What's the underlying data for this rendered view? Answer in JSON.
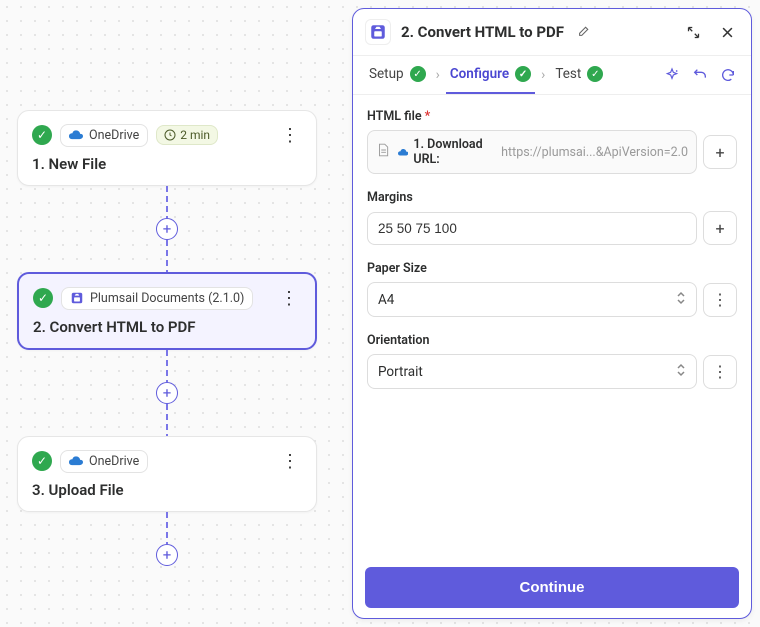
{
  "workflow": {
    "nodes": [
      {
        "app": "OneDrive",
        "timer": "2 min",
        "title": "1. New File",
        "icon": "onedrive"
      },
      {
        "app": "Plumsail Documents (2.1.0)",
        "title": "2. Convert HTML to PDF",
        "icon": "plumsail",
        "selected": true
      },
      {
        "app": "OneDrive",
        "title": "3. Upload File",
        "icon": "onedrive"
      }
    ]
  },
  "panel": {
    "title": "2. Convert HTML to PDF",
    "tabs": {
      "setup": "Setup",
      "configure": "Configure",
      "test": "Test"
    },
    "form": {
      "html_file_label": "HTML file",
      "html_file_chip": "1. Download URL:",
      "html_file_url": "https://plumsai...&ApiVersion=2.0",
      "margins_label": "Margins",
      "margins_value": "25 50 75 100",
      "paper_size_label": "Paper Size",
      "paper_size_value": "A4",
      "orientation_label": "Orientation",
      "orientation_value": "Portrait"
    },
    "continue": "Continue"
  }
}
